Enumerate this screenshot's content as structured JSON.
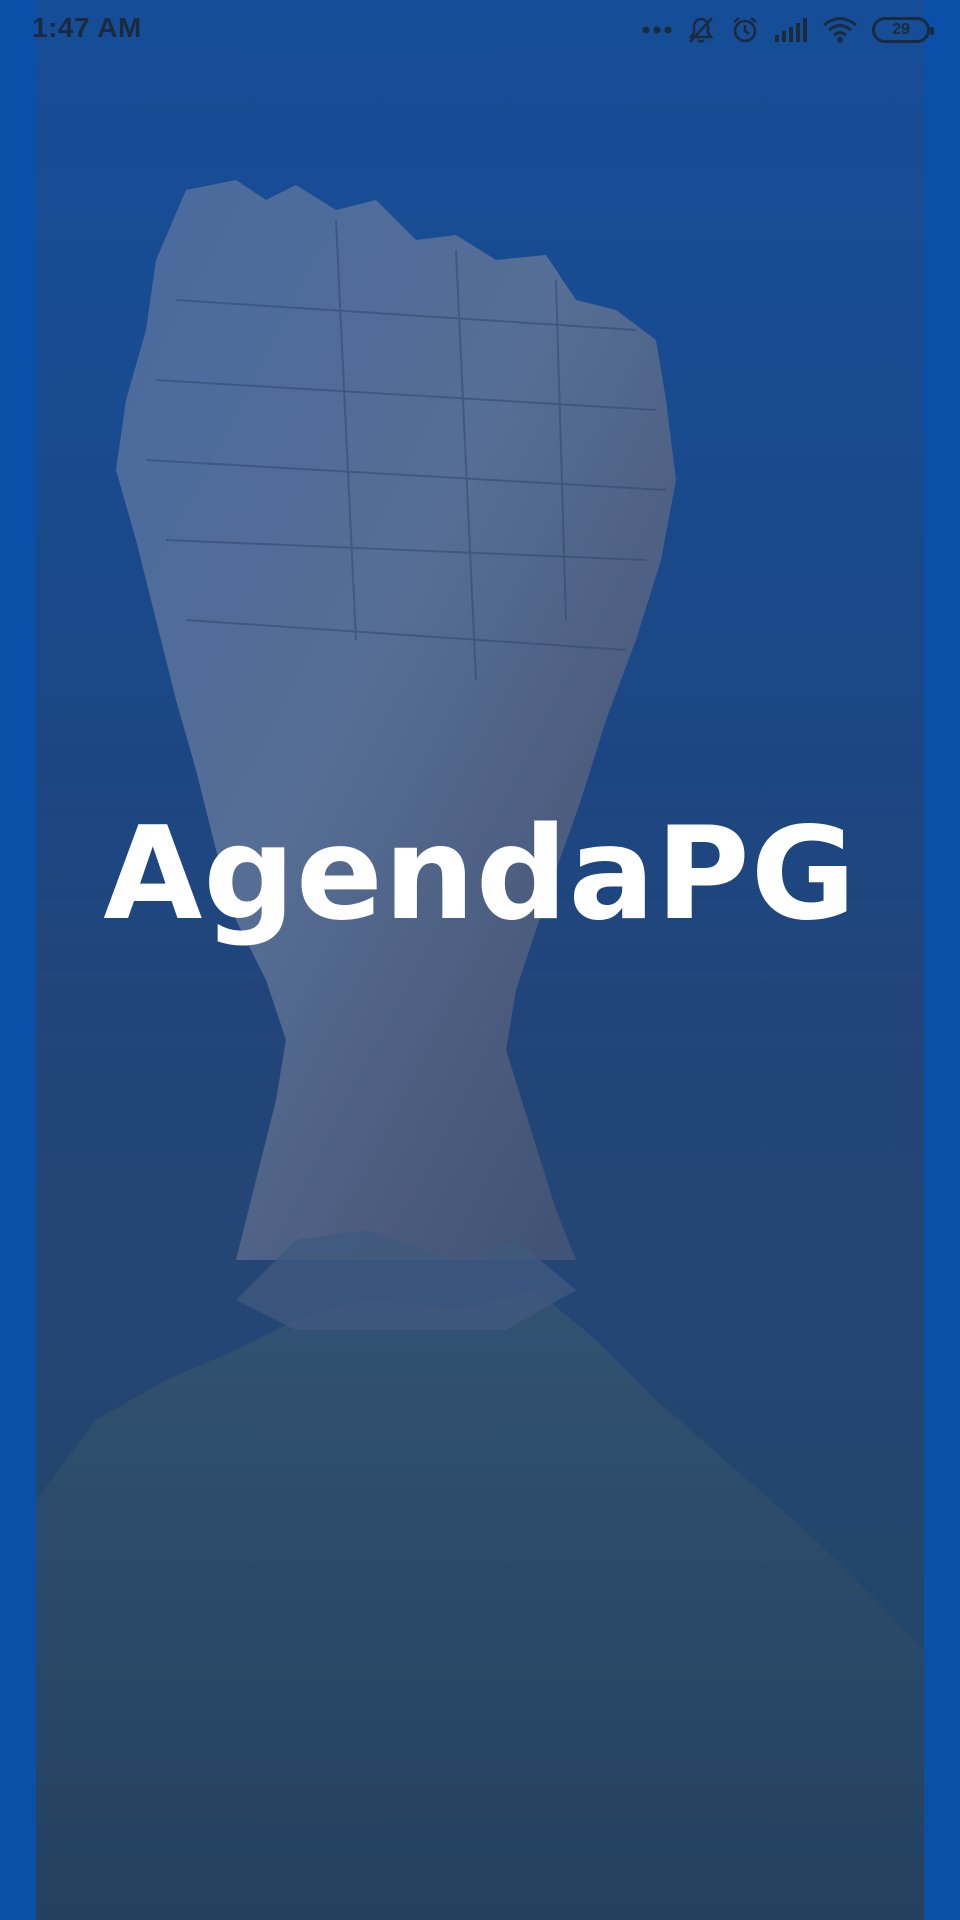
{
  "status_bar": {
    "time": "1:47 AM",
    "battery_level": "29",
    "icons": [
      "more-dots-icon",
      "bell-muted-icon",
      "alarm-icon",
      "signal-icon",
      "wifi-icon",
      "battery-icon"
    ]
  },
  "splash": {
    "app_name": "AgendaPG",
    "background": "rock-formation-photo"
  },
  "colors": {
    "side_bars": "#0a4fa8",
    "overlay": "#0c3c8c",
    "title": "#ffffff",
    "status_text": "#1c2a3e"
  }
}
